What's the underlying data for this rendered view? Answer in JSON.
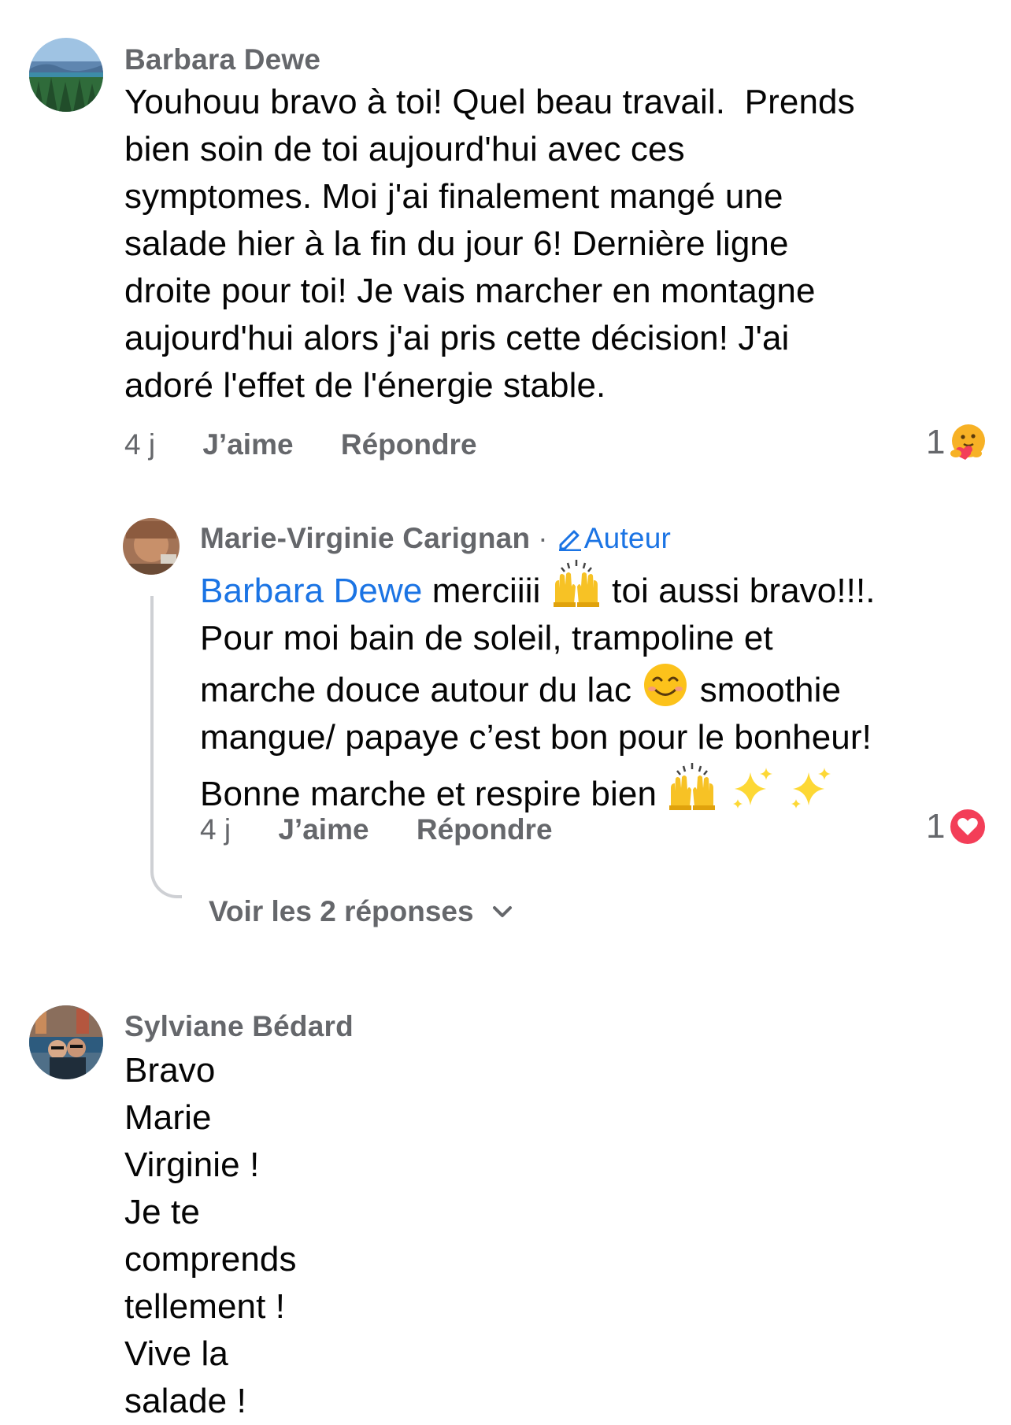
{
  "comments": [
    {
      "author": "Barbara Dewe",
      "lines": [
        "Youhouu bravo à toi! Quel beau travail.  Prends",
        "bien soin de toi aujourd'hui avec ces",
        "symptomes. Moi j'ai finalement mangé une",
        "salade hier à la fin du jour 6! Dernière ligne",
        "droite pour toi! Je vais marcher en montagne",
        "aujourd'hui alors j'ai pris cette décision! J'ai",
        "adoré l'effet de l'énergie stable."
      ],
      "time": "4 j",
      "like_label": "J’aime",
      "reply_label": "Répondre",
      "reaction_count": "1",
      "reaction_icon": "care-emoji-icon"
    },
    {
      "author": "Marie-Virginie Carignan",
      "separator": "·",
      "badge": "Auteur",
      "mention": "Barbara Dewe",
      "line1_a": "merciiii",
      "line1_b": "toi aussi bravo!!!.",
      "line2": "Pour moi bain de soleil, trampoline et",
      "line3_a": "marche douce autour du lac",
      "line3_b": "smoothie",
      "line4": "mangue/ papaye c’est bon pour le bonheur!",
      "line5": "Bonne marche et respire bien",
      "time": "4 j",
      "like_label": "J’aime",
      "reply_label": "Répondre",
      "reaction_count": "1",
      "reaction_icon": "love-heart-icon"
    },
    {
      "author": "Sylviane Bédard",
      "lines": [
        "Bravo Marie Virginie ! Je te comprends",
        "tellement ! Vive la salade !"
      ]
    }
  ],
  "more_replies_label": "Voir les 2 réponses",
  "colors": {
    "meta_gray": "#65676b",
    "link_blue": "#1b74e4",
    "love_red": "#f33e58",
    "thread_line": "#ced0d4"
  }
}
